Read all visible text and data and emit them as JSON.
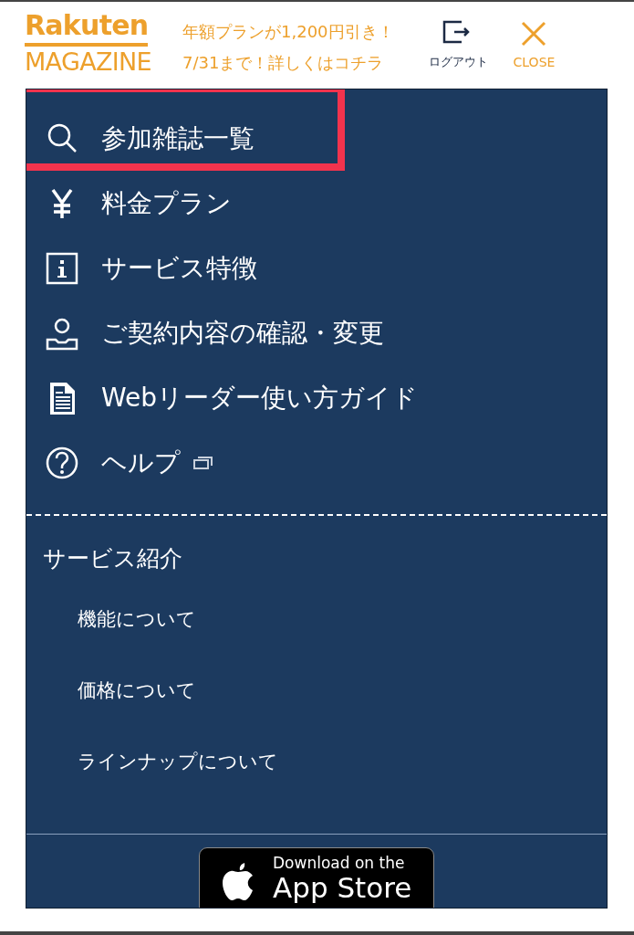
{
  "header": {
    "logo_top": "Rakuten",
    "logo_bottom": "MAGAZINE",
    "promo_lines": [
      "年額プランが1,200円引き！",
      "7/31まで！詳しくはコチラ"
    ],
    "logout": "ログアウト",
    "close": "CLOSE"
  },
  "menu": [
    {
      "kind": "search",
      "label": "参加雑誌一覧",
      "highlighted": true
    },
    {
      "kind": "yen",
      "label": "料金プラン",
      "highlighted": false
    },
    {
      "kind": "info",
      "label": "サービス特徴",
      "highlighted": false
    },
    {
      "kind": "user",
      "label": "ご契約内容の確認・変更",
      "highlighted": false
    },
    {
      "kind": "document",
      "label": "Webリーダー使い方ガイド",
      "highlighted": false
    },
    {
      "kind": "help",
      "label": "ヘルプ",
      "highlighted": false,
      "external": true
    }
  ],
  "service_section": {
    "title": "サービス紹介",
    "links": [
      "機能について",
      "価格について",
      "ラインナップについて"
    ]
  },
  "app_badge": {
    "small": "Download on the",
    "large": "App Store"
  }
}
